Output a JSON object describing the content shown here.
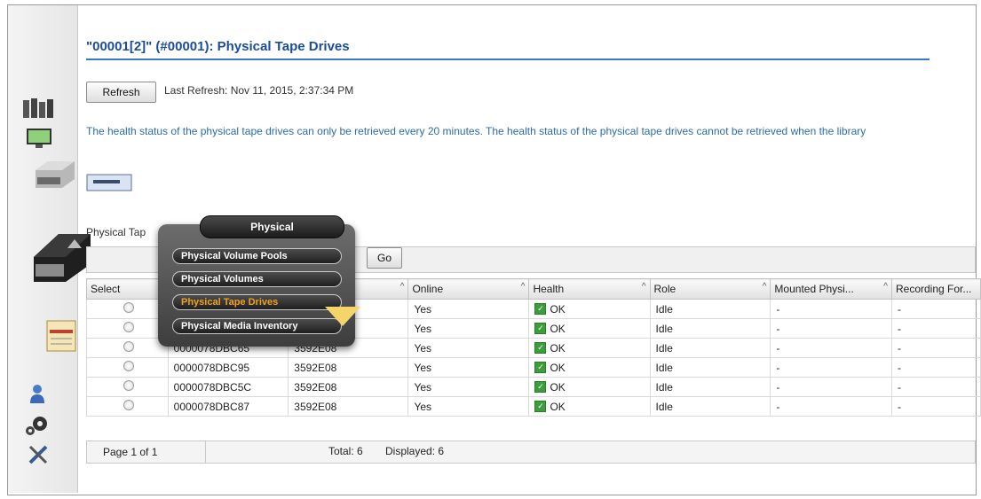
{
  "page": {
    "title": "\"00001[2]\" (#00001): Physical Tape Drives",
    "refresh_label": "Refresh",
    "last_refresh_label": "Last Refresh:",
    "last_refresh_value": "Nov 11, 2015, 2:37:34 PM",
    "info_text": "The health status of the physical tape drives can only be retrieved every 20 minutes. The health status of the physical tape drives cannot be retrieved when the library",
    "section_label": "Physical Tap",
    "go_label": "Go"
  },
  "popup": {
    "header": "Physical",
    "items": [
      {
        "label": "Physical Volume Pools"
      },
      {
        "label": "Physical Volumes"
      },
      {
        "label": "Physical Tape Drives"
      },
      {
        "label": "Physical Media Inventory"
      }
    ]
  },
  "table": {
    "columns": [
      "Select",
      "",
      "",
      "Online",
      "Health",
      "Role",
      "Mounted Physi...",
      "Recording For..."
    ],
    "rows": [
      {
        "serial": "",
        "type": "",
        "online": "Yes",
        "health": "OK",
        "role": "Idle",
        "mounted": "-",
        "recording": "-"
      },
      {
        "serial": "",
        "type": "",
        "online": "Yes",
        "health": "OK",
        "role": "Idle",
        "mounted": "-",
        "recording": "-"
      },
      {
        "serial": "0000078DBC65",
        "type": "3592E08",
        "online": "Yes",
        "health": "OK",
        "role": "Idle",
        "mounted": "-",
        "recording": "-"
      },
      {
        "serial": "0000078DBC95",
        "type": "3592E08",
        "online": "Yes",
        "health": "OK",
        "role": "Idle",
        "mounted": "-",
        "recording": "-"
      },
      {
        "serial": "0000078DBC5C",
        "type": "3592E08",
        "online": "Yes",
        "health": "OK",
        "role": "Idle",
        "mounted": "-",
        "recording": "-"
      },
      {
        "serial": "0000078DBC87",
        "type": "3592E08",
        "online": "Yes",
        "health": "OK",
        "role": "Idle",
        "mounted": "-",
        "recording": "-"
      }
    ]
  },
  "pager": {
    "page": "Page 1 of 1",
    "total": "Total: 6",
    "displayed": "Displayed: 6"
  },
  "sidebar": {
    "icons": [
      "cluster-icon",
      "monitor-icon",
      "virtual-library-icon",
      "drive-icon",
      "physical-library-icon",
      "policies-icon",
      "user-icon",
      "settings-icon",
      "tools-icon"
    ]
  },
  "colors": {
    "title": "#1a4d9a",
    "info": "#2c6ca8",
    "menu_active": "#f0a020",
    "health_ok": "#3c9d3a"
  }
}
